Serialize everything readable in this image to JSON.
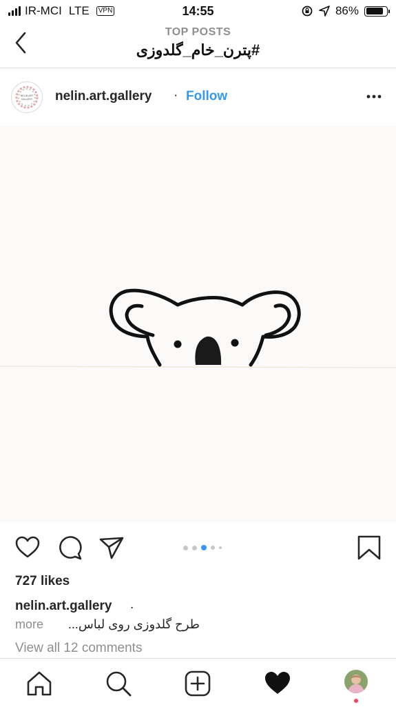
{
  "status_bar": {
    "carrier": "IR-MCI",
    "network": "LTE",
    "vpn": "VPN",
    "time": "14:55",
    "battery": "86%",
    "battery_level": 0.86
  },
  "nav": {
    "subtitle": "TOP POSTS",
    "title": "#پترن_خام_گلدوزی"
  },
  "post": {
    "username": "nelin.art.gallery",
    "avatar_text": "NELIN ART GALLERY",
    "separator": "·",
    "follow": "Follow",
    "likes": "727 likes",
    "caption_user": "nelin.art.gallery",
    "caption_dot": ".",
    "caption_text": "طرح گلدوزی روی لباس...",
    "caption_more": "more",
    "view_comments": "View all 12 comments",
    "carousel_active_index": 2
  },
  "icons": {
    "back": "chevron-left-icon",
    "more": "more-horizontal-icon",
    "like": "heart-icon",
    "comment": "comment-icon",
    "share": "send-icon",
    "save": "bookmark-icon",
    "home": "home-icon",
    "search": "search-icon",
    "new_post": "plus-square-icon",
    "activity": "heart-filled-icon",
    "profile": "avatar"
  },
  "colors": {
    "follow_blue": "#3897f0",
    "carousel_active": "#3897f0",
    "notification": "#ed4956"
  }
}
